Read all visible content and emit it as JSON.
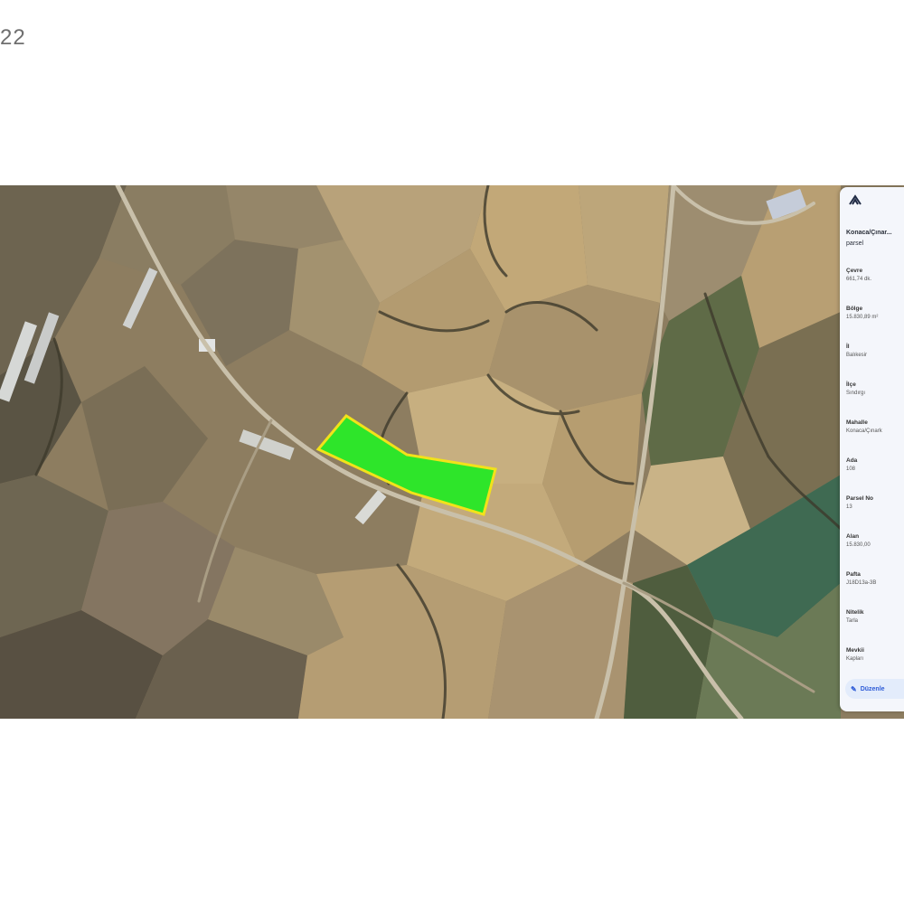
{
  "corner_text": "22",
  "panel": {
    "logo_icon": "tkgm-logo-icon",
    "title": "Konaca/Çınar...",
    "subtitle": "parsel",
    "fields": [
      {
        "label": "Çevre",
        "value": "661,74 dk."
      },
      {
        "label": "Bölge",
        "value": "15.830,89 m²"
      },
      {
        "label": "İl",
        "value": "Balıkesir"
      },
      {
        "label": "İlçe",
        "value": "Sındırgı"
      },
      {
        "label": "Mahalle",
        "value": "Konaca/Çınark"
      },
      {
        "label": "Ada",
        "value": "108"
      },
      {
        "label": "Parsel No",
        "value": "13"
      },
      {
        "label": "Alan",
        "value": "15.830,00"
      },
      {
        "label": "Pafta",
        "value": "J18D13a-3B"
      },
      {
        "label": "Nitelik",
        "value": "Tarla"
      },
      {
        "label": "Mevkii",
        "value": "Kapları"
      }
    ],
    "edit_label": "Düzenle"
  },
  "map": {
    "highlight_fill": "#2ee52a",
    "highlight_stroke": "#f2e21a"
  }
}
